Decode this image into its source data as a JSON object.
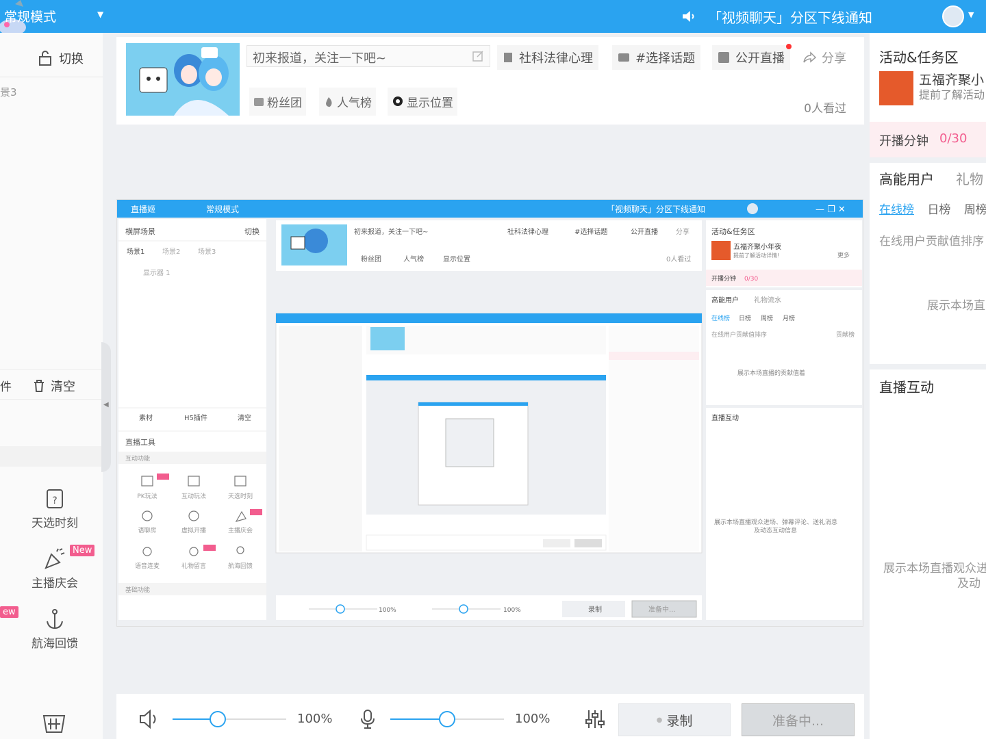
{
  "topbar": {
    "mode_label": "常规模式",
    "notice": "「视频聊天」分区下线通知"
  },
  "left": {
    "switch_label": "切换",
    "scene_label": "景3",
    "fragment_label": "件",
    "clear_label": "清空",
    "tools": [
      {
        "label": "天选时刻",
        "icon": "gift-draw-icon"
      },
      {
        "label": "主播庆会",
        "icon": "party-icon",
        "badge": "New"
      },
      {
        "label": "航海回馈",
        "icon": "anchor-icon"
      }
    ],
    "partial_badge": "ew"
  },
  "header": {
    "title_placeholder": "初来报道，关注一下吧~",
    "category": "社科法律心理",
    "topic": "#选择话题",
    "public_live": "公开直播",
    "share": "分享",
    "fan_club": "粉丝团",
    "popularity": "人气榜",
    "show_location": "显示位置",
    "views": "0人看过"
  },
  "bottom": {
    "speaker_pct": "100%",
    "speaker_level": 0.4,
    "mic_pct": "100%",
    "mic_level": 0.5,
    "record_label": "录制",
    "ready_label": "准备中..."
  },
  "right": {
    "activity_title": "活动&任务区",
    "activity_name": "五福齐聚小",
    "activity_sub": "提前了解活动",
    "broadcast_minutes_label": "开播分钟",
    "broadcast_minutes_value": "0/30",
    "high_energy_label": "高能用户",
    "gift_flow_label": "礼物",
    "tab_online": "在线榜",
    "tab_daily": "日榜",
    "tab_weekly": "周榜",
    "online_hint": "在线用户贡献值排序",
    "show_contribution": "展示本场直",
    "interaction_title": "直播互动",
    "interaction_hint_1": "展示本场直播观众进",
    "interaction_hint_2": "及动"
  },
  "preview": {
    "app_title": "直播姬",
    "mode": "常规模式",
    "notice": "「视频聊天」分区下线通知",
    "scene_header": "横屏场景",
    "switch": "切换",
    "scenes": [
      "场景1",
      "场景2",
      "场景3"
    ],
    "display": "显示器 1",
    "material": "素材",
    "h5": "H5插件",
    "clear": "清空",
    "live_tools": "直播工具",
    "interactive": "互动功能",
    "basic": "基础功能",
    "tools": [
      "PK玩法",
      "互动玩法",
      "天选时刻",
      "语聊房",
      "虚拟开播",
      "主播庆会",
      "语音连麦",
      "礼物留言",
      "航海回馈"
    ],
    "title": "初来报道，关注一下吧~",
    "category": "社科法律心理",
    "topic": "#选择话题",
    "public_live": "公开直播",
    "share": "分享",
    "fan_club": "粉丝团",
    "popularity": "人气榜",
    "location": "显示位置",
    "views": "0人看过",
    "activity": "活动&任务区",
    "act_name": "五福齐聚小年夜",
    "act_sub": "提前了解活动详情!",
    "more": "更多",
    "minutes": "开播分钟",
    "minutes_val": "0/30",
    "high_energy": "高能用户",
    "gift_flow": "礼物流水",
    "rank_tabs": [
      "在线榜",
      "日榜",
      "周榜",
      "月榜"
    ],
    "online_sort": "在线用户贡献值排序",
    "contrib": "贡献榜",
    "show_rank": "展示本场直播的贡献值着",
    "interaction": "直播互动",
    "interaction_hint_1": "展示本场直播观众进场、弹幕评论、送礼消息",
    "interaction_hint_2": "及动态互动信息",
    "pct1": "100%",
    "pct2": "100%",
    "record": "录制",
    "ready": "准备中..."
  }
}
